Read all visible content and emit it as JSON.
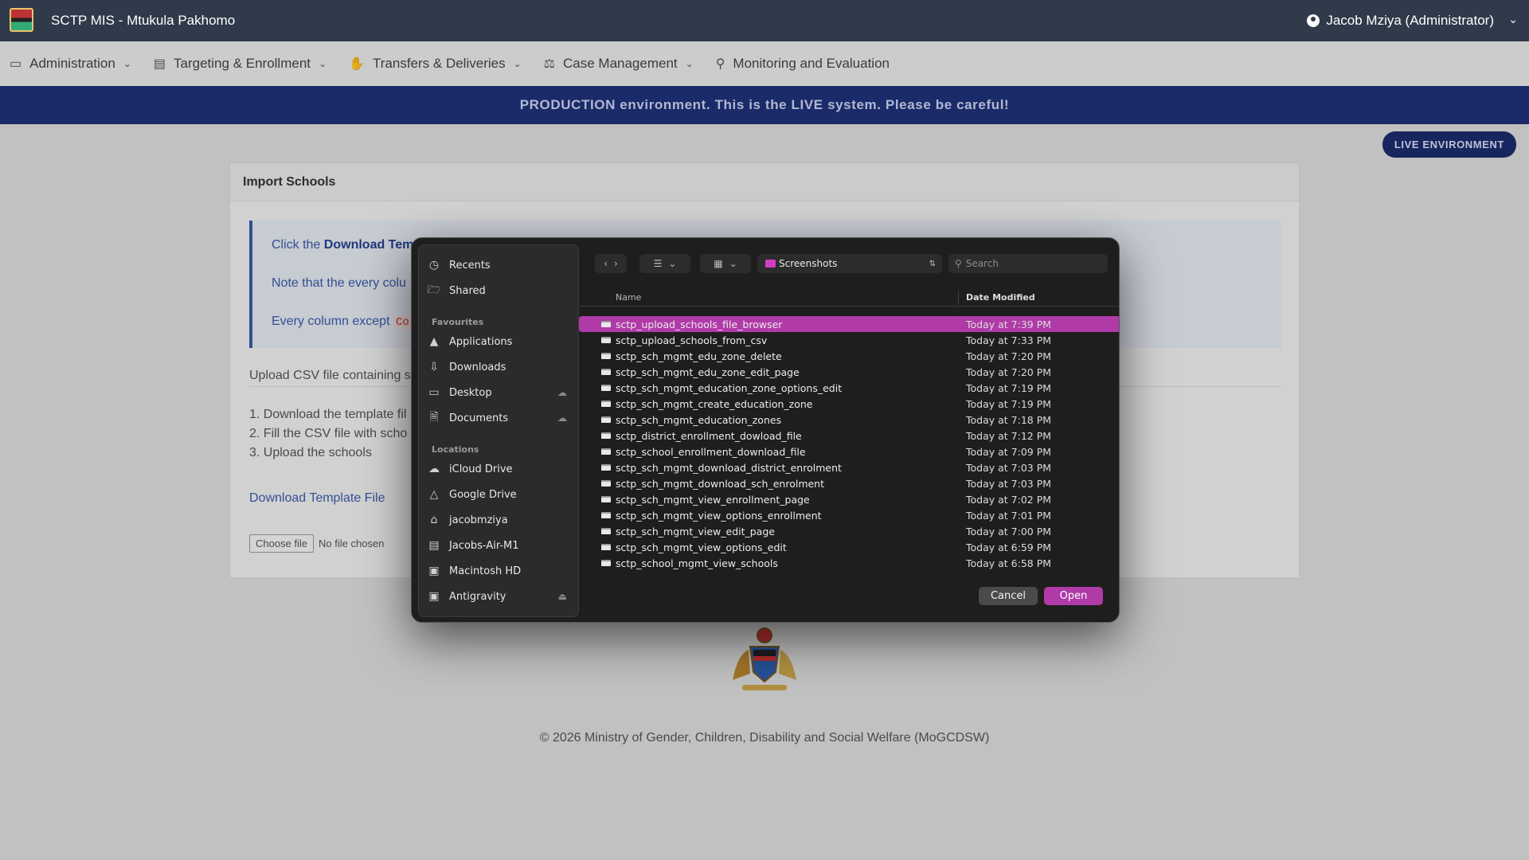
{
  "app": {
    "title": "SCTP MIS - Mtukula Pakhomo",
    "user": "Jacob Mziya (Administrator)"
  },
  "nav": {
    "items": [
      {
        "label": "Administration",
        "icon": "monitor-icon",
        "has_dropdown": true
      },
      {
        "label": "Targeting & Enrollment",
        "icon": "clipboard-icon",
        "has_dropdown": true
      },
      {
        "label": "Transfers & Deliveries",
        "icon": "hand-coin-icon",
        "has_dropdown": true
      },
      {
        "label": "Case Management",
        "icon": "scale-icon",
        "has_dropdown": true
      },
      {
        "label": "Monitoring and Evaluation",
        "icon": "search-icon",
        "has_dropdown": false
      }
    ]
  },
  "banner": {
    "text": "PRODUCTION environment. This is the LIVE system. Please be careful!"
  },
  "live_badge": "LIVE ENVIRONMENT",
  "card": {
    "title": "Import Schools",
    "info_1_prefix": "Click the ",
    "info_1_bold": "Download Tem",
    "info_2": "Note that the every colu",
    "info_3_prefix": "Every column except ",
    "info_3_code": "Co",
    "upload_text": "Upload CSV file containing s",
    "steps": [
      "1. Download the template fil",
      "2. Fill the CSV file with scho",
      "3. Upload the schools"
    ],
    "download_link": "Download Template File",
    "choose_file": "Choose file",
    "no_file": "No file chosen"
  },
  "footer": "© 2026 Ministry of Gender, Children, Disability and Social Welfare (MoGCDSW)",
  "dialog": {
    "sidebar": {
      "top": [
        {
          "label": "Recents",
          "icon": "clock-icon"
        },
        {
          "label": "Shared",
          "icon": "shared-folder-icon"
        }
      ],
      "favourites_header": "Favourites",
      "favourites": [
        {
          "label": "Applications",
          "icon": "applications-icon"
        },
        {
          "label": "Downloads",
          "icon": "download-icon"
        },
        {
          "label": "Desktop",
          "icon": "desktop-icon",
          "cloud": true
        },
        {
          "label": "Documents",
          "icon": "document-icon",
          "cloud": true
        }
      ],
      "locations_header": "Locations",
      "locations": [
        {
          "label": "iCloud Drive",
          "icon": "cloud-icon"
        },
        {
          "label": "Google Drive",
          "icon": "google-drive-icon"
        },
        {
          "label": "jacobmziya",
          "icon": "home-icon"
        },
        {
          "label": "Jacobs-Air-M1",
          "icon": "laptop-icon"
        },
        {
          "label": "Macintosh HD",
          "icon": "disk-icon"
        },
        {
          "label": "Antigravity",
          "icon": "disk-icon",
          "eject": true
        }
      ]
    },
    "folder": "Screenshots",
    "search_placeholder": "Search",
    "columns": {
      "name": "Name",
      "date": "Date Modified"
    },
    "files": [
      {
        "name": "sctp_upload_schools_file_browser",
        "date": "Today at 7:39 PM",
        "selected": true
      },
      {
        "name": "sctp_upload_schools_from_csv",
        "date": "Today at 7:33 PM"
      },
      {
        "name": "sctp_sch_mgmt_edu_zone_delete",
        "date": "Today at 7:20 PM"
      },
      {
        "name": "sctp_sch_mgmt_edu_zone_edit_page",
        "date": "Today at 7:20 PM"
      },
      {
        "name": "sctp_sch_mgmt_education_zone_options_edit",
        "date": "Today at 7:19 PM"
      },
      {
        "name": "sctp_sch_mgmt_create_education_zone",
        "date": "Today at 7:19 PM"
      },
      {
        "name": "sctp_sch_mgmt_education_zones",
        "date": "Today at 7:18 PM"
      },
      {
        "name": "sctp_district_enrollment_dowload_file",
        "date": "Today at 7:12 PM"
      },
      {
        "name": "sctp_school_enrollment_download_file",
        "date": "Today at 7:09 PM"
      },
      {
        "name": "sctp_sch_mgmt_download_district_enrolment",
        "date": "Today at 7:03 PM"
      },
      {
        "name": "sctp_sch_mgmt_download_sch_enrolment",
        "date": "Today at 7:03 PM"
      },
      {
        "name": "sctp_sch_mgmt_view_enrollment_page",
        "date": "Today at 7:02 PM"
      },
      {
        "name": "sctp_sch_mgmt_view_options_enrollment",
        "date": "Today at 7:01 PM"
      },
      {
        "name": "sctp_sch_mgmt_view_edit_page",
        "date": "Today at 7:00 PM"
      },
      {
        "name": "sctp_sch_mgmt_view_options_edit",
        "date": "Today at 6:59 PM"
      },
      {
        "name": "sctp_school_mgmt_view_schools",
        "date": "Today at 6:58 PM"
      }
    ],
    "cancel": "Cancel",
    "open": "Open"
  }
}
